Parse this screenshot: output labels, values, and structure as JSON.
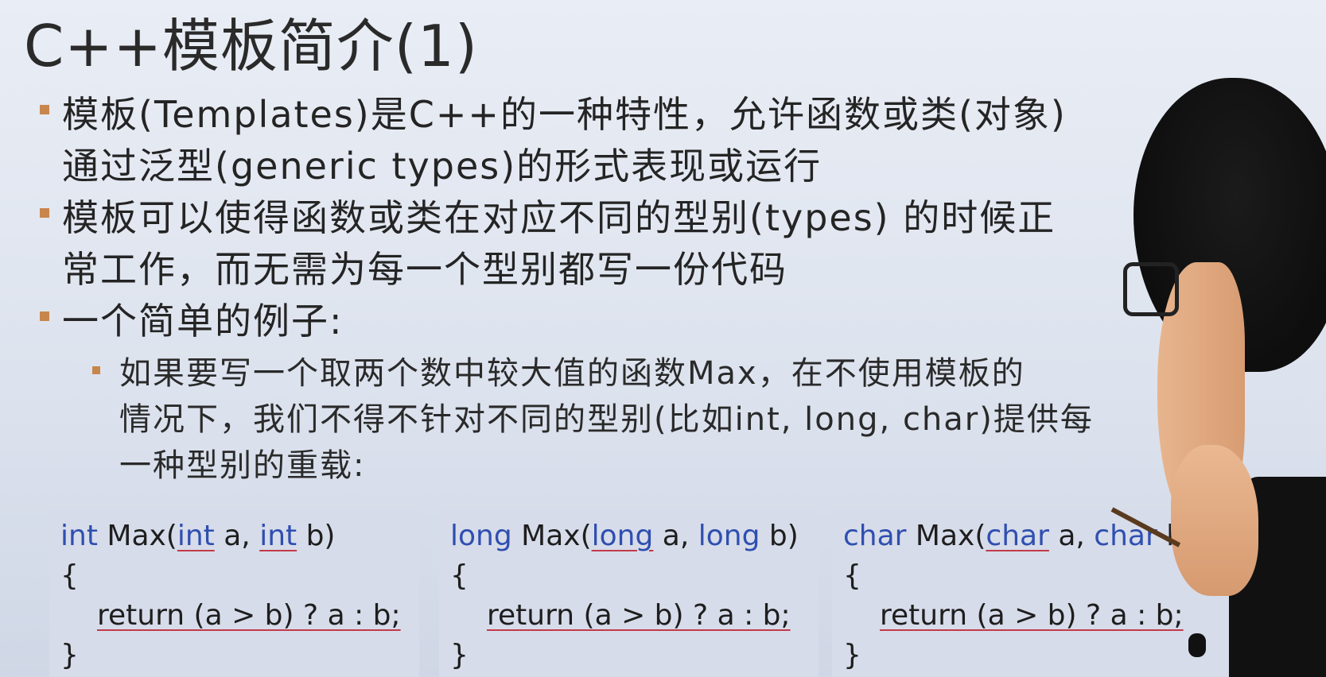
{
  "slide": {
    "title": "C++模板简介(1)",
    "bullets": [
      {
        "lines": [
          "模板(Templates)是C++的一种特性，允许函数或类(对象)",
          "通过泛型(generic types)的形式表现或运行"
        ]
      },
      {
        "lines": [
          "模板可以使得函数或类在对应不同的型别(types) 的时候正",
          "常工作，而无需为每一个型别都写一份代码"
        ]
      },
      {
        "lines": [
          "一个简单的例子:"
        ]
      }
    ],
    "sub_bullet": {
      "lines": [
        "如果要写一个取两个数中较大值的函数Max，在不使用模板的",
        "情况下，我们不得不针对不同的型别(比如int, long, char)提供每",
        "一种型别的重载:"
      ]
    },
    "code_blocks": [
      {
        "signature_type": "int",
        "signature_rest": " Max(",
        "param1_type": "int",
        "param1_name": " a, ",
        "param2_type": "int",
        "param2_name": " b)",
        "open_brace": "{",
        "body": "return (a > b) ? a : b;",
        "close_brace": "}"
      },
      {
        "signature_type": "long",
        "signature_rest": " Max(",
        "param1_type": "long",
        "param1_name": " a, ",
        "param2_type": "long",
        "param2_name": " b)",
        "open_brace": "{",
        "body": "return (a > b) ? a : b;",
        "close_brace": "}"
      },
      {
        "signature_type": "char",
        "signature_rest": " Max(",
        "param1_type": "char",
        "param1_name": " a, ",
        "param2_type": "char",
        "param2_name": " b",
        "open_brace": "{",
        "body": "return (a > b) ? a : b;",
        "close_brace": "}"
      }
    ]
  },
  "colors": {
    "bullet_marker": "#c8864d",
    "keyword": "#2f4fb0",
    "ink_annotation": "#c23a4a",
    "code_background": "#d7dcea"
  }
}
